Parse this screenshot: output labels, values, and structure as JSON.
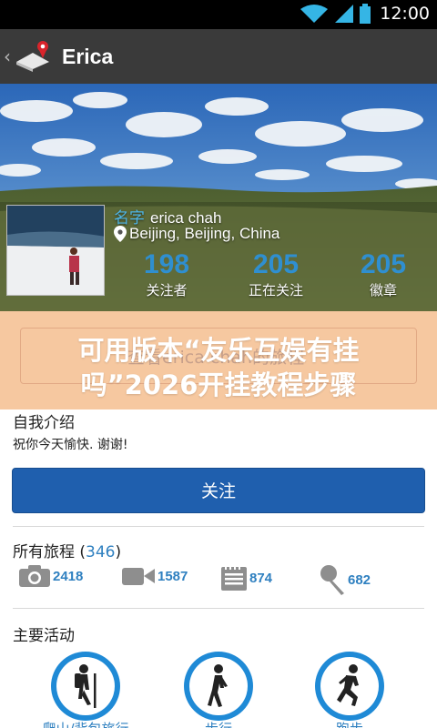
{
  "status_bar": {
    "time": "12:00",
    "icons": [
      "wifi-icon",
      "signal-icon",
      "battery-icon"
    ]
  },
  "action_bar": {
    "title": "Erica",
    "logo": "app-logo-icon",
    "back": "back-chevron-icon"
  },
  "profile": {
    "name_label": "名字",
    "name": "erica chah",
    "location": "Beijing, Beijing, China",
    "stats": [
      {
        "value": "198",
        "label": "关注者"
      },
      {
        "value": "205",
        "label": "正在关注"
      },
      {
        "value": "205",
        "label": "徽章"
      }
    ]
  },
  "banner": {
    "headline_line1": "可用版本“友乐互娱有挂",
    "headline_line2": "吗”2026开挂教程步骤",
    "ghost_button": "查看erica chah的旅程"
  },
  "about": {
    "title": "自我介绍",
    "text": "祝你今天愉快. 谢谢!"
  },
  "follow_button": "关注",
  "trips": {
    "title": "所有旅程 (",
    "count": "346",
    "title_end": ")",
    "stats": [
      {
        "icon": "camera-icon",
        "value": "2418"
      },
      {
        "icon": "video-icon",
        "value": "1587"
      },
      {
        "icon": "notes-icon",
        "value": "874"
      },
      {
        "icon": "microphone-icon",
        "value": "682"
      }
    ]
  },
  "activities": {
    "title": "主要活动",
    "items": [
      {
        "icon": "hiking-icon",
        "label": "爬山/背包旅行"
      },
      {
        "icon": "walking-icon",
        "label": "步行"
      },
      {
        "icon": "running-icon",
        "label": "跑步"
      }
    ]
  },
  "colors": {
    "accent": "#1f5fae",
    "stat_blue": "#2f8fd0",
    "banner_bg": "#f6c8a0",
    "action_bar": "#3a3a3a"
  }
}
